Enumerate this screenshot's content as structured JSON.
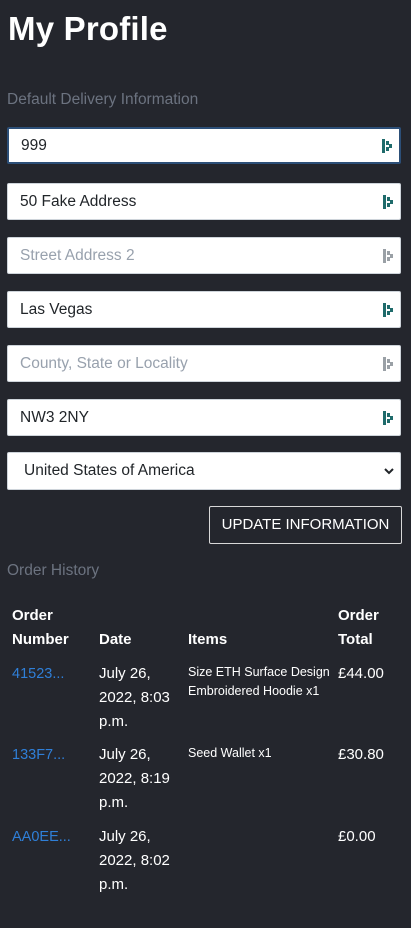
{
  "page": {
    "title": "My Profile"
  },
  "delivery": {
    "label": "Default Delivery Information",
    "fields": [
      {
        "value": "999",
        "placeholder": "",
        "focused": true,
        "icon": "password-manager-key-icon"
      },
      {
        "value": "50 Fake Address",
        "placeholder": "",
        "icon": "password-manager-key-icon"
      },
      {
        "value": "",
        "placeholder": "Street Address 2",
        "icon": "password-manager-key-icon"
      },
      {
        "value": "Las Vegas",
        "placeholder": "",
        "icon": "password-manager-key-icon"
      },
      {
        "value": "",
        "placeholder": "County, State or Locality",
        "icon": "password-manager-key-icon"
      },
      {
        "value": "NW3 2NY",
        "placeholder": "",
        "icon": "password-manager-key-icon"
      }
    ],
    "country": {
      "selected": "United States of America",
      "icon": "chevron-down-icon"
    },
    "update_label": "UPDATE INFORMATION"
  },
  "orders": {
    "label": "Order History",
    "headers": {
      "number_line1": "Order",
      "number_line2": "Number",
      "date": "Date",
      "items": "Items",
      "total_line1": "Order",
      "total_line2": "Total"
    },
    "rows": [
      {
        "number": "41523...",
        "date_line1": "July 26,",
        "date_line2": "2022, 8:03",
        "date_line3": "p.m.",
        "items": "Size ETH Surface Design Embroidered Hoodie x1",
        "total": "£44.00"
      },
      {
        "number": "133F7...",
        "date_line1": "July 26,",
        "date_line2": "2022, 8:19",
        "date_line3": "p.m.",
        "items": "Seed Wallet x1",
        "total": "£30.80"
      },
      {
        "number": "AA0EE...",
        "date_line1": "July 26,",
        "date_line2": "2022, 8:02",
        "date_line3": "p.m.",
        "items": "",
        "total": "£0.00"
      }
    ]
  },
  "colors": {
    "background": "#24262d",
    "link": "#2f7fd8",
    "muted_label": "#6c7380",
    "key_icon_active": "#1f6b6b",
    "key_icon_inactive": "#9aa0a6"
  }
}
